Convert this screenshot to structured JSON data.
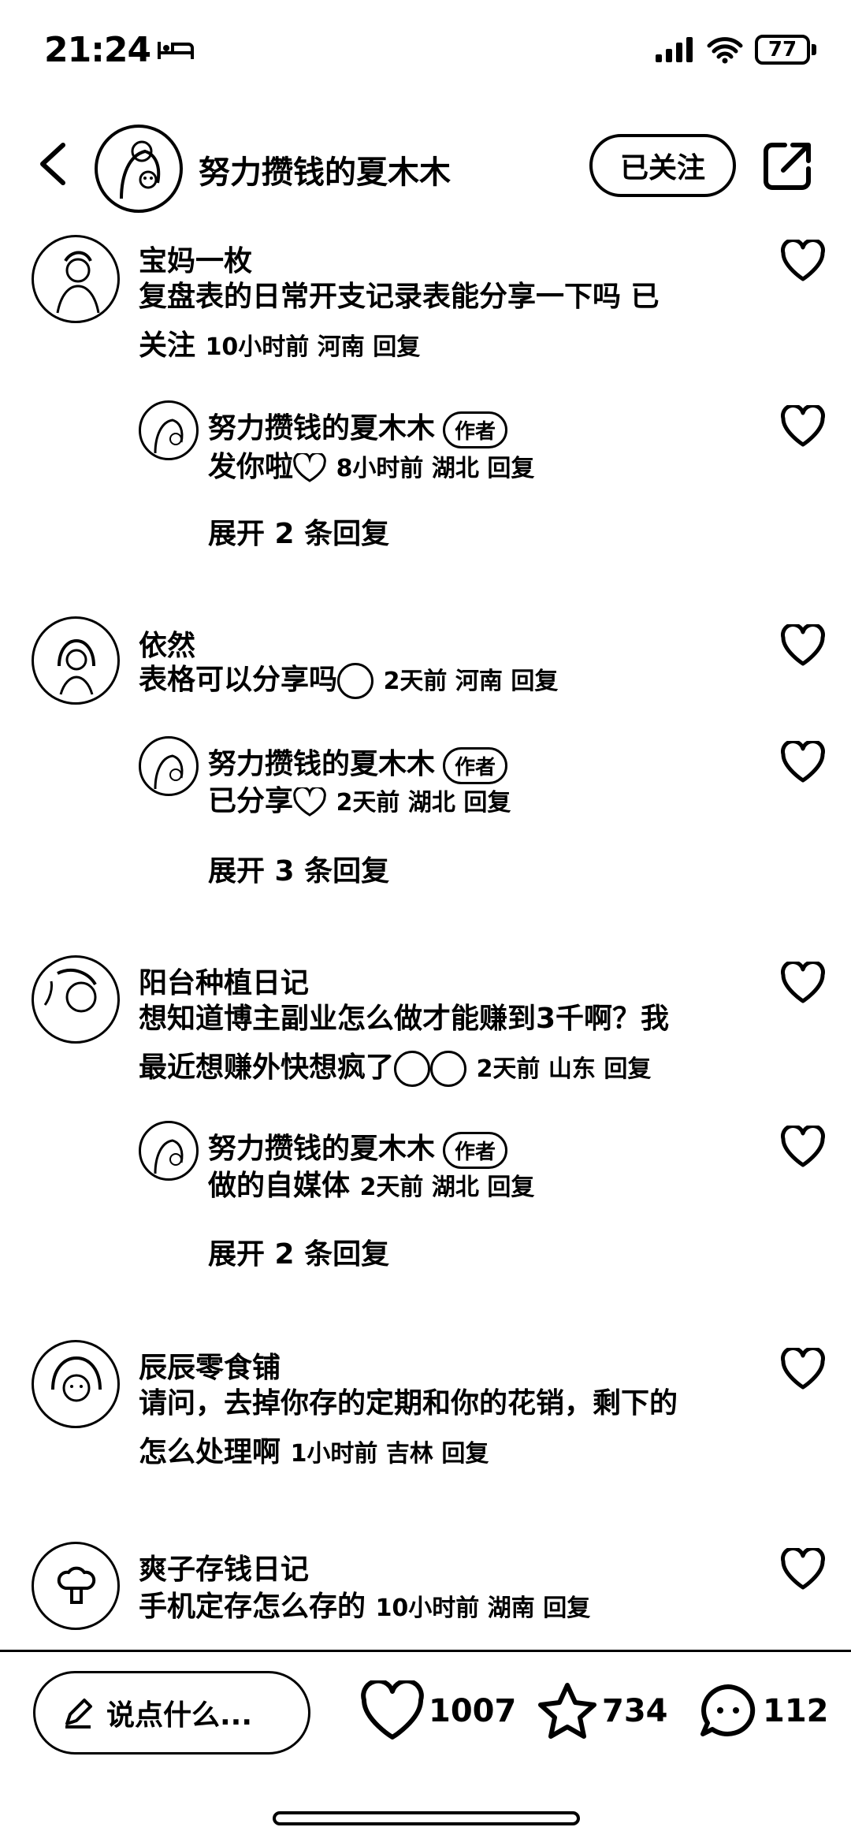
{
  "status": {
    "time": "21:24",
    "battery": "77"
  },
  "header": {
    "title": "努力攒钱的夏木木",
    "follow_label": "已关注"
  },
  "comments": [
    {
      "name": "宝妈一枚",
      "line1": "复盘表的日常开支记录表能分享一下吗 已",
      "line2": "关注",
      "meta": "10小时前 河南 回复",
      "reply": {
        "name": "努力攒钱的夏木木",
        "badge": "作者",
        "text": "发你啦",
        "meta": "8小时前 湖北 回复"
      },
      "expand": "展开 2 条回复"
    },
    {
      "name": "依然",
      "line1": "表格可以分享吗",
      "meta": "2天前 河南 回复",
      "reply": {
        "name": "努力攒钱的夏木木",
        "badge": "作者",
        "text": "已分享",
        "meta": "2天前 湖北 回复"
      },
      "expand": "展开 3 条回复"
    },
    {
      "name": "阳台种植日记",
      "line1": "想知道博主副业怎么做才能赚到3千啊？我",
      "line2": "最近想赚外快想疯了",
      "meta": "2天前 山东 回复",
      "reply": {
        "name": "努力攒钱的夏木木",
        "badge": "作者",
        "text": "做的自媒体",
        "meta": "2天前 湖北 回复"
      },
      "expand": "展开 2 条回复"
    },
    {
      "name": "辰辰零食铺",
      "line1": "请问，去掉你存的定期和你的花销，剩下的",
      "line2": "怎么处理啊",
      "meta": "1小时前 吉林 回复"
    },
    {
      "name": "爽子存钱日记",
      "line1": "手机定存怎么存的",
      "meta": "10小时前 湖南 回复"
    }
  ],
  "bottom": {
    "input_placeholder": "说点什么...",
    "likes": "1007",
    "favorites": "734",
    "comments": "112"
  }
}
